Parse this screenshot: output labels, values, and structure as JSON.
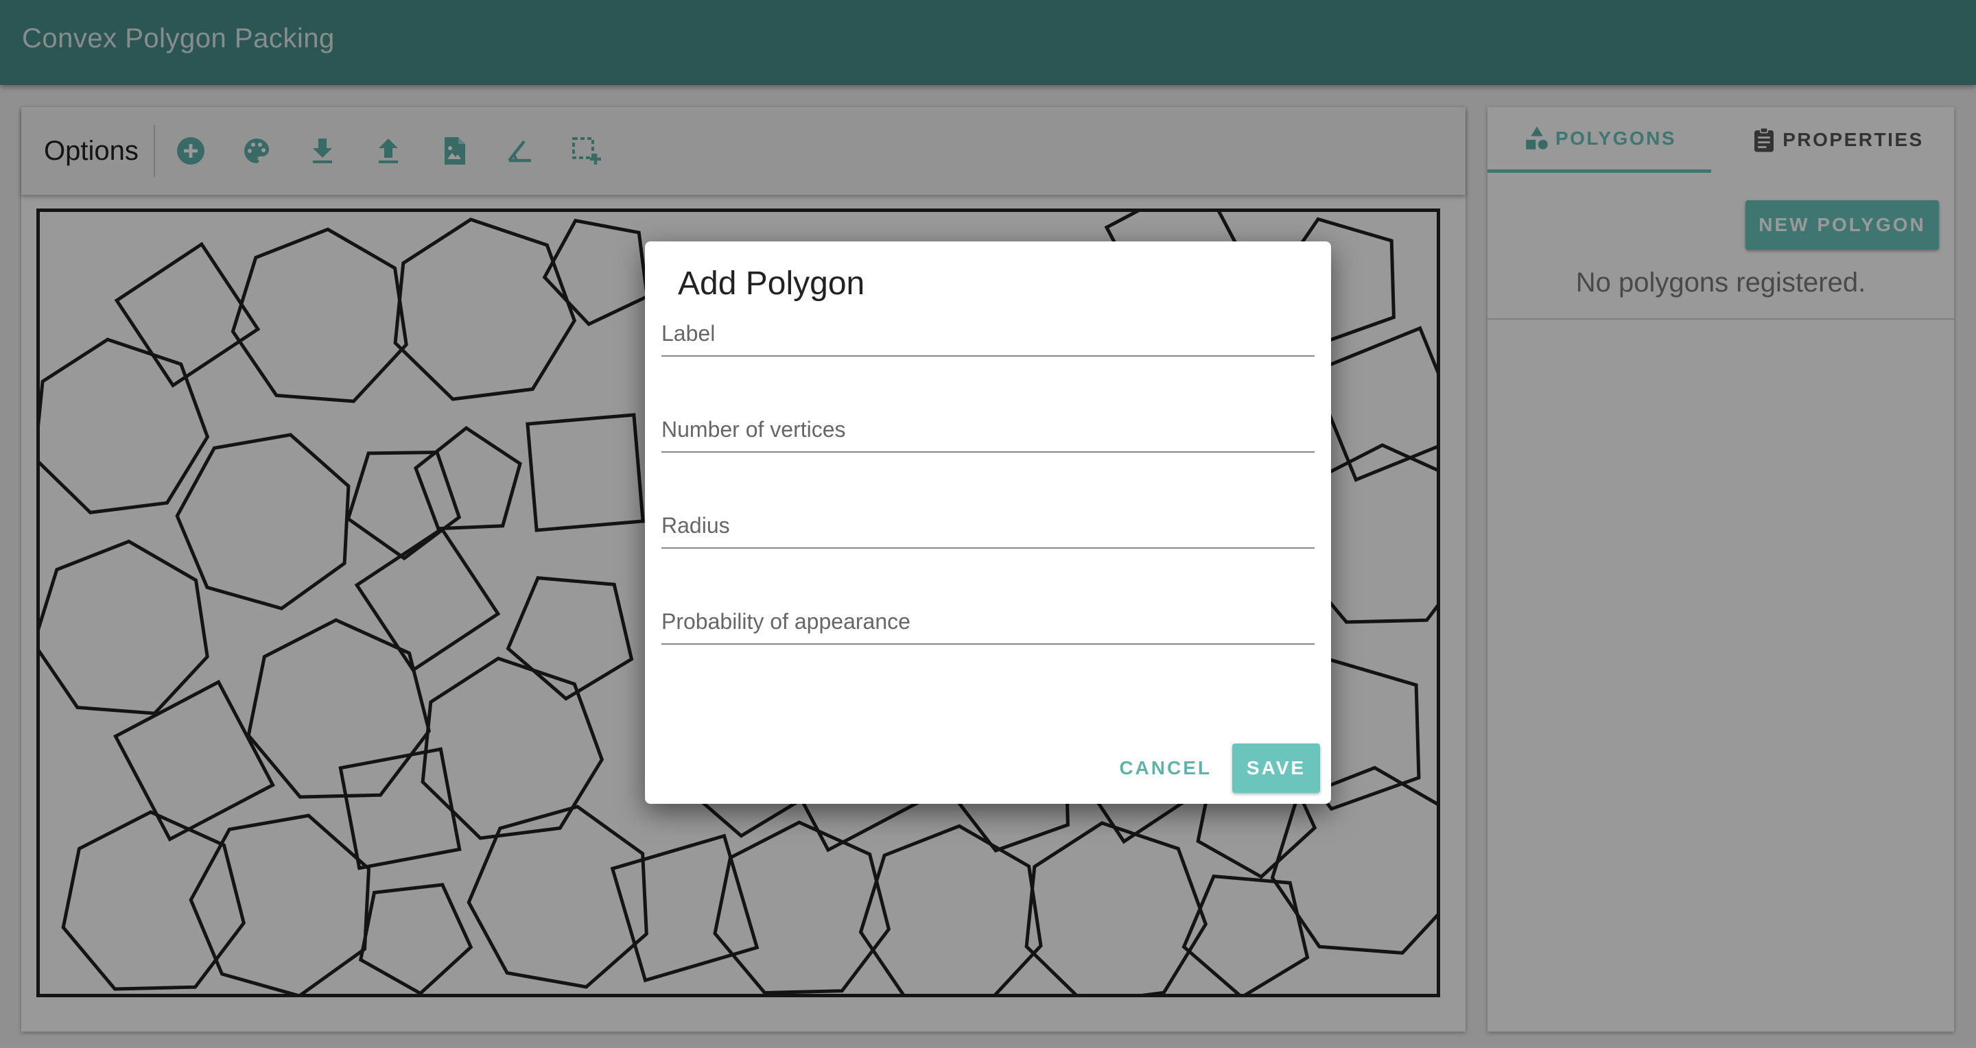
{
  "app": {
    "title": "Convex Polygon Packing"
  },
  "toolbar": {
    "title": "Options",
    "tools": [
      {
        "icon": "add-circle-icon"
      },
      {
        "icon": "palette-icon"
      },
      {
        "icon": "download-icon"
      },
      {
        "icon": "upload-icon"
      },
      {
        "icon": "image-file-icon"
      },
      {
        "icon": "angle-icon"
      },
      {
        "icon": "selection-add-icon"
      }
    ]
  },
  "sidebar": {
    "tabs": [
      {
        "label": "POLYGONS",
        "icon": "shapes-icon",
        "active": true
      },
      {
        "label": "PROPERTIES",
        "icon": "clipboard-icon",
        "active": false
      }
    ],
    "new_button": "NEW POLYGON",
    "empty_message": "No polygons registered."
  },
  "dialog": {
    "title": "Add Polygon",
    "fields": [
      {
        "placeholder": "Label",
        "value": ""
      },
      {
        "placeholder": "Number of vertices",
        "value": ""
      },
      {
        "placeholder": "Radius",
        "value": ""
      },
      {
        "placeholder": "Probability of appearance",
        "value": ""
      }
    ],
    "cancel_label": "CANCEL",
    "save_label": "SAVE"
  },
  "colors": {
    "app_bar": "#4a908a",
    "accent": "#6cc5bd",
    "overlay": "rgba(0,0,0,0.4)"
  }
}
